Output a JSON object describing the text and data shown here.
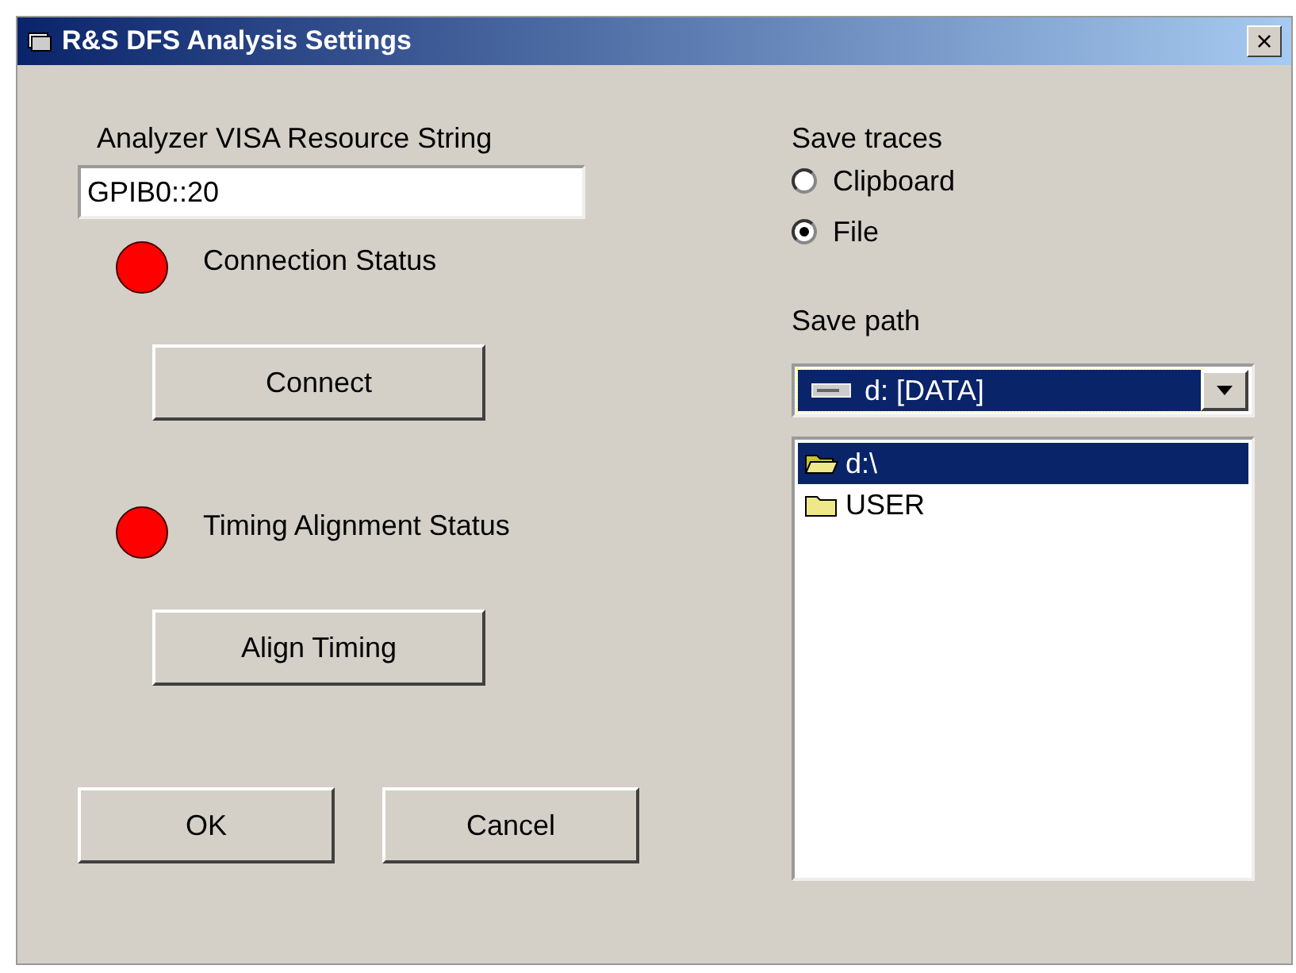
{
  "window": {
    "title": "R&S DFS Analysis Settings",
    "close": "×"
  },
  "resource": {
    "label": "Analyzer VISA Resource String",
    "value": "GPIB0::20"
  },
  "statuses": [
    {
      "label": "Connection Status",
      "color": "#ff0000",
      "button": "Connect"
    },
    {
      "label": "Timing Alignment Status",
      "color": "#ff0000",
      "button": "Align Timing"
    }
  ],
  "buttons": [
    "OK",
    "Cancel"
  ],
  "save_traces": {
    "label": "Save traces",
    "options": [
      {
        "label": "Clipboard",
        "selected": false
      },
      {
        "label": "File",
        "selected": true
      }
    ]
  },
  "save_path": {
    "label": "Save path",
    "drive": "d: [DATA]",
    "folders": [
      {
        "label": "d:\\",
        "kind": "open",
        "selected": true
      },
      {
        "label": "USER",
        "kind": "closed",
        "selected": false
      }
    ]
  }
}
